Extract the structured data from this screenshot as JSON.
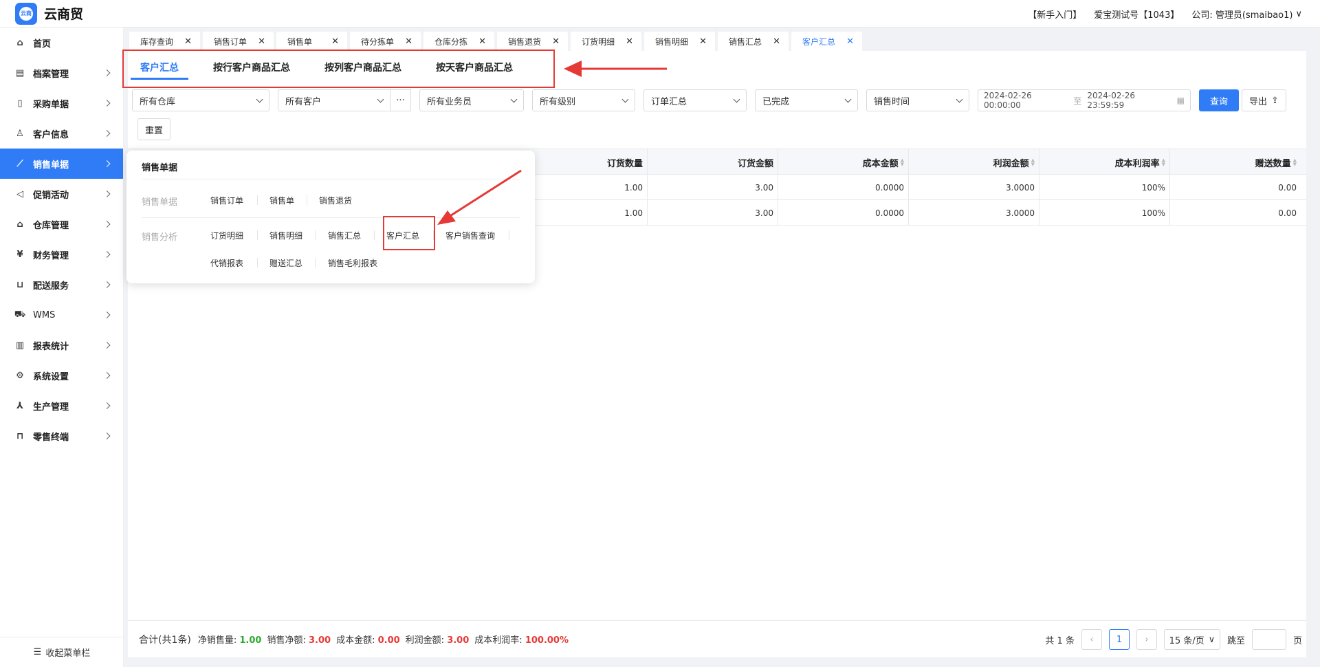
{
  "app": {
    "brand": "云商贸",
    "logo_text": "云商"
  },
  "topbar": {
    "guide": "【新手入门】",
    "account": "爱宝测试号【1043】",
    "company": "公司: 管理员(smaibao1)"
  },
  "sidebar": {
    "items": [
      {
        "label": "首页",
        "icon": "home-icon"
      },
      {
        "label": "档案管理",
        "icon": "archive-icon"
      },
      {
        "label": "采购单据",
        "icon": "document-icon"
      },
      {
        "label": "客户信息",
        "icon": "user-icon"
      },
      {
        "label": "销售单据",
        "icon": "chart-icon"
      },
      {
        "label": "促销活动",
        "icon": "megaphone-icon"
      },
      {
        "label": "仓库管理",
        "icon": "warehouse-icon"
      },
      {
        "label": "财务管理",
        "icon": "finance-icon"
      },
      {
        "label": "配送服务",
        "icon": "cart-icon"
      },
      {
        "label": "WMS",
        "icon": "truck-icon"
      },
      {
        "label": "报表统计",
        "icon": "bar-chart-icon"
      },
      {
        "label": "系统设置",
        "icon": "gear-icon"
      },
      {
        "label": "生产管理",
        "icon": "network-icon"
      },
      {
        "label": "零售终端",
        "icon": "bag-icon"
      }
    ],
    "collapse": "收起菜单栏"
  },
  "tabs": [
    "库存查询",
    "销售订单",
    "销售单",
    "待分拣单",
    "仓库分拣",
    "销售退货",
    "订货明细",
    "销售明细",
    "销售汇总",
    "客户汇总"
  ],
  "subtabs": [
    "客户汇总",
    "按行客户商品汇总",
    "按列客户商品汇总",
    "按天客户商品汇总"
  ],
  "filters": {
    "warehouse": "所有仓库",
    "customer": "所有客户",
    "salesman": "所有业务员",
    "level": "所有级别",
    "summary": "订单汇总",
    "status": "已完成",
    "time_type": "销售时间",
    "date_from": "2024-02-26 00:00:00",
    "date_sep": "至",
    "date_to": "2024-02-26 23:59:59",
    "query": "查询",
    "export": "导出",
    "reset": "重置"
  },
  "table": {
    "headers": [
      "订货数量",
      "订货金额",
      "成本金额",
      "利润金额",
      "成本利润率",
      "赠送数量"
    ],
    "rows": [
      [
        "1.00",
        "3.00",
        "0.0000",
        "3.0000",
        "100%",
        "0.00"
      ],
      [
        "1.00",
        "3.00",
        "0.0000",
        "3.0000",
        "100%",
        "0.00"
      ]
    ]
  },
  "menu": {
    "title": "销售单据",
    "cat1": "销售单据",
    "cat1_links": [
      "销售订单",
      "销售单",
      "销售退货"
    ],
    "cat2": "销售分析",
    "cat2_links": [
      "订货明细",
      "销售明细",
      "销售汇总",
      "客户汇总",
      "客户销售查询"
    ],
    "cat2_links_row2": [
      "代销报表",
      "赠送汇总",
      "销售毛利报表"
    ]
  },
  "summary": {
    "label": "合计(共1条)",
    "net_qty_label": "净销售量:",
    "net_qty": "1.00",
    "net_amt_label": "销售净额:",
    "net_amt": "3.00",
    "cost_label": "成本金额:",
    "cost": "0.00",
    "profit_label": "利润金额:",
    "profit": "3.00",
    "rate_label": "成本利润率:",
    "rate": "100.00%"
  },
  "pager": {
    "total": "共 1 条",
    "page": "1",
    "size": "15 条/页",
    "jump": "跳至",
    "page_unit": "页"
  },
  "colors": {
    "primary": "#2f7cf6",
    "annotation": "#e53935",
    "green": "#2eaa2e"
  }
}
